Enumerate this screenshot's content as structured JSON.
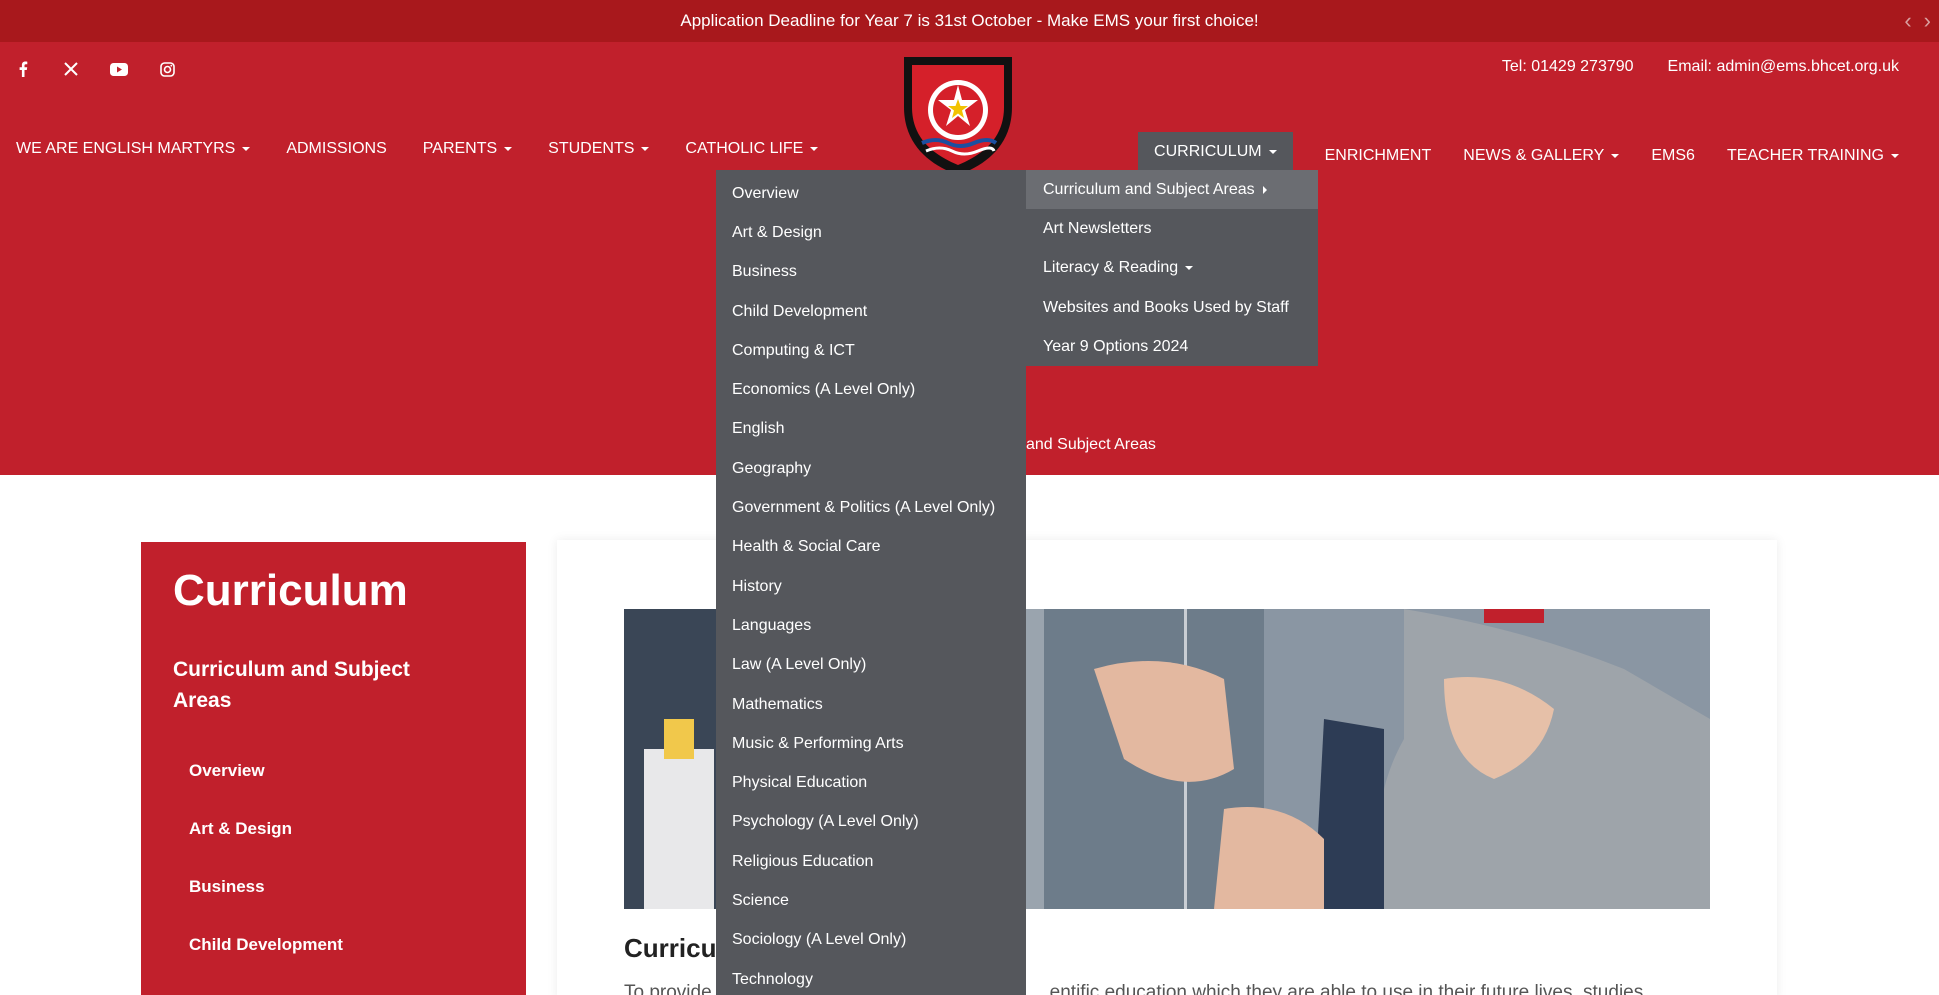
{
  "announcement": {
    "text": "Application Deadline for Year 7 is 31st October - Make EMS your first choice!",
    "prev_icon": "chevron-left-icon",
    "next_icon": "chevron-right-icon"
  },
  "social": [
    "facebook-icon",
    "x-icon",
    "youtube-icon",
    "instagram-icon"
  ],
  "contact": {
    "tel": "Tel: 01429 273790",
    "email": "Email: admin@ems.bhcet.org.uk"
  },
  "nav_left": [
    {
      "label": "WE ARE ENGLISH MARTYRS",
      "dropdown": true
    },
    {
      "label": "ADMISSIONS",
      "dropdown": false
    },
    {
      "label": "PARENTS",
      "dropdown": true
    },
    {
      "label": "STUDENTS",
      "dropdown": true
    },
    {
      "label": "CATHOLIC LIFE",
      "dropdown": true
    }
  ],
  "nav_right": [
    {
      "label": "CURRICULUM",
      "dropdown": true,
      "active": true
    },
    {
      "label": "ENRICHMENT",
      "dropdown": false
    },
    {
      "label": "NEWS & GALLERY",
      "dropdown": true
    },
    {
      "label": "EMS6",
      "dropdown": false
    },
    {
      "label": "TEACHER TRAINING",
      "dropdown": true
    }
  ],
  "breadcrumb_fragment": "and Subject Areas",
  "dropdown_main": [
    "Overview",
    "Art & Design",
    "Business",
    "Child Development",
    "Computing & ICT",
    "Economics (A Level Only)",
    "English",
    "Geography",
    "Government & Politics (A Level Only)",
    "Health & Social Care",
    "History",
    "Languages",
    "Law (A Level Only)",
    "Mathematics",
    "Music & Performing Arts",
    "Physical Education",
    "Psychology (A Level Only)",
    "Religious Education",
    "Science",
    "Sociology (A Level Only)",
    "Technology"
  ],
  "dropdown_sub": [
    {
      "label": "Curriculum and Subject Areas",
      "arrow": "right",
      "highlight": true
    },
    {
      "label": "Art Newsletters"
    },
    {
      "label": "Literacy & Reading",
      "arrow": "down"
    },
    {
      "label": "Websites and Books Used by Staff"
    },
    {
      "label": "Year 9 Options 2024"
    }
  ],
  "sidebar": {
    "title": "Curriculum",
    "subtitle": "Curriculum and Subject Areas",
    "items": [
      "Overview",
      "Art & Design",
      "Business",
      "Child Development"
    ]
  },
  "content": {
    "title": "Curricu",
    "text_left": "To provide",
    "text_right": "entific education which they are able to use in their future lives, studies"
  },
  "colors": {
    "brand_red": "#c1202c",
    "announce_red": "#a8181c",
    "dropdown_grey": "#55575c"
  }
}
